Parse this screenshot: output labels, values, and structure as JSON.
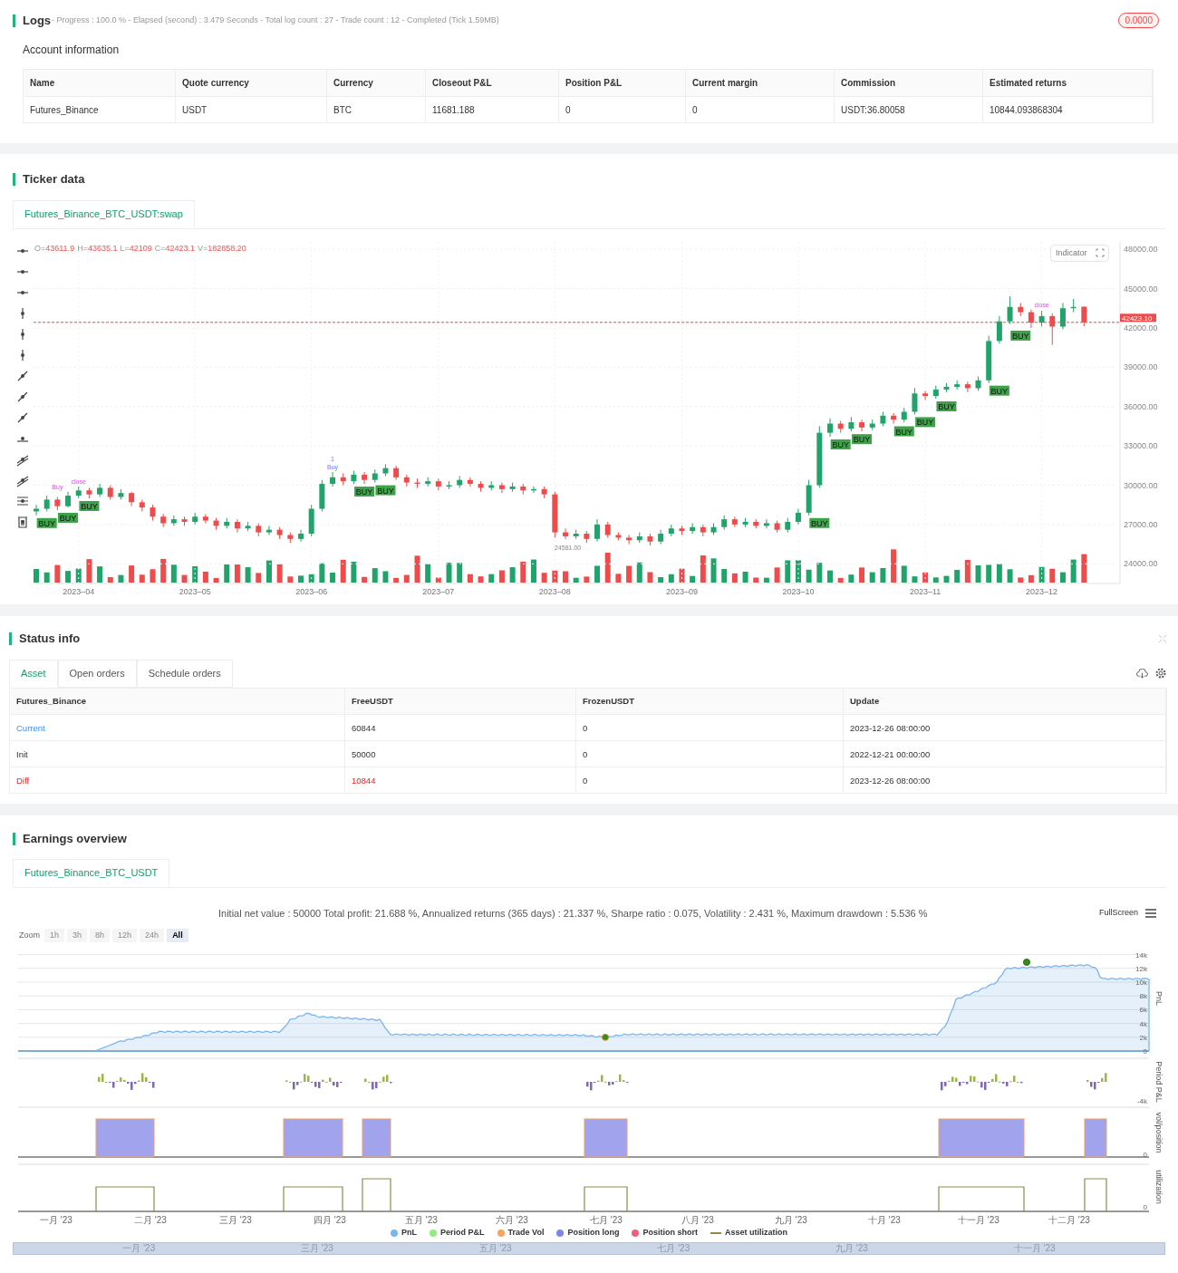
{
  "logs": {
    "title": "Logs",
    "progress": "- Progress : 100.0 % - Elapsed (second) : 3.479  Seconds - Total log count : 27 - Trade count : 12 - Completed (Tick 1.59MB)",
    "badge": "0.0000"
  },
  "account": {
    "title": "Account information",
    "columns": [
      "Name",
      "Quote currency",
      "Currency",
      "Closeout P&L",
      "Position P&L",
      "Current margin",
      "Commission",
      "Estimated returns"
    ],
    "rows": [
      [
        "Futures_Binance",
        "USDT",
        "BTC",
        "11681.188",
        "0",
        "0",
        "USDT:36.80058",
        "10844.093868304"
      ]
    ]
  },
  "ticker": {
    "title": "Ticker data",
    "tabs": [
      {
        "label": "Futures_Binance_BTC_USDT:swap",
        "selected": true
      }
    ],
    "ohlc": [
      {
        "label": "O=",
        "value": "43611.9"
      },
      {
        "label": "H=",
        "value": "43635.1"
      },
      {
        "label": "L=",
        "value": "42109"
      },
      {
        "label": "C=",
        "value": "42423.1"
      },
      {
        "label": "V=",
        "value": "182858.20"
      }
    ],
    "indicator_button": "Indicator",
    "low_label": "24581.00",
    "chart_data": {
      "type": "candlestick",
      "ylim": [
        22500,
        48560
      ],
      "grid": true,
      "ref_lines": [
        {
          "axis": "y",
          "value": 42423.1,
          "label": "42423.10"
        }
      ],
      "yticks": [
        {
          "value": 48000,
          "label": "48000.00"
        },
        {
          "value": 45000,
          "label": "45000.00"
        },
        {
          "value": 42000,
          "label": "42000.00"
        },
        {
          "value": 39000,
          "label": "39000.00"
        },
        {
          "value": 36000,
          "label": "36000.00"
        },
        {
          "value": 33000,
          "label": "33000.00"
        },
        {
          "value": 30000,
          "label": "30000.00"
        },
        {
          "value": 27000,
          "label": "27000.00"
        },
        {
          "value": 24000,
          "label": "24000.00"
        }
      ],
      "categories": [
        null,
        null,
        null,
        null,
        "2023–04",
        null,
        null,
        null,
        null,
        null,
        null,
        null,
        null,
        null,
        null,
        "2023–05",
        null,
        null,
        null,
        null,
        null,
        null,
        null,
        null,
        null,
        null,
        "2023–06",
        null,
        null,
        null,
        null,
        null,
        null,
        null,
        null,
        null,
        null,
        null,
        "2023–07",
        null,
        null,
        null,
        null,
        null,
        null,
        null,
        null,
        null,
        null,
        "2023–08",
        null,
        null,
        null,
        null,
        null,
        null,
        null,
        null,
        null,
        null,
        null,
        "2023–09",
        null,
        null,
        null,
        null,
        null,
        null,
        null,
        null,
        null,
        null,
        "2023–10",
        null,
        null,
        null,
        null,
        null,
        null,
        null,
        null,
        null,
        null,
        null,
        "2023–11",
        null,
        null,
        null,
        null,
        null,
        null,
        null,
        null,
        null,
        null,
        "2023–12",
        null,
        null,
        null,
        null
      ],
      "ohlc": [
        [
          28000,
          28500,
          27700,
          28200
        ],
        [
          28200,
          29200,
          28000,
          28900
        ],
        [
          28900,
          29100,
          28100,
          28400
        ],
        [
          28400,
          29500,
          28300,
          29200
        ],
        [
          29200,
          29900,
          29000,
          29600
        ],
        [
          29600,
          29800,
          29000,
          29300
        ],
        [
          29300,
          30100,
          29100,
          29800
        ],
        [
          29800,
          30000,
          28900,
          29100
        ],
        [
          29100,
          29700,
          28900,
          29400
        ],
        [
          29400,
          29500,
          28400,
          28700
        ],
        [
          28700,
          28900,
          28000,
          28300
        ],
        [
          28300,
          28500,
          27300,
          27600
        ],
        [
          27600,
          27800,
          26800,
          27100
        ],
        [
          27100,
          27700,
          26900,
          27400
        ],
        [
          27400,
          27600,
          26900,
          27200
        ],
        [
          27200,
          27900,
          27000,
          27600
        ],
        [
          27600,
          27800,
          27100,
          27300
        ],
        [
          27300,
          27500,
          26600,
          26900
        ],
        [
          26900,
          27500,
          26700,
          27200
        ],
        [
          27200,
          27400,
          26400,
          26700
        ],
        [
          26700,
          27200,
          26500,
          26900
        ],
        [
          26900,
          27100,
          26100,
          26400
        ],
        [
          26400,
          26900,
          26200,
          26600
        ],
        [
          26600,
          26800,
          25900,
          26200
        ],
        [
          26200,
          26400,
          25600,
          25900
        ],
        [
          25900,
          26600,
          25700,
          26300
        ],
        [
          26300,
          28500,
          26100,
          28200
        ],
        [
          28200,
          30400,
          28000,
          30100
        ],
        [
          30100,
          31000,
          29900,
          30600
        ],
        [
          30600,
          30900,
          30000,
          30300
        ],
        [
          30300,
          31100,
          30100,
          30800
        ],
        [
          30800,
          31000,
          30100,
          30400
        ],
        [
          30400,
          31200,
          30200,
          30900
        ],
        [
          30900,
          31600,
          30700,
          31300
        ],
        [
          31300,
          31500,
          30400,
          30600
        ],
        [
          30600,
          30800,
          29900,
          30200
        ],
        [
          30200,
          30500,
          29800,
          30100
        ],
        [
          30100,
          30600,
          29900,
          30300
        ],
        [
          30300,
          30500,
          29600,
          29900
        ],
        [
          29900,
          30300,
          29700,
          30000
        ],
        [
          30000,
          30700,
          29800,
          30400
        ],
        [
          30400,
          30600,
          29900,
          30100
        ],
        [
          30100,
          30300,
          29500,
          29800
        ],
        [
          29800,
          30300,
          29600,
          30000
        ],
        [
          30000,
          30200,
          29400,
          29700
        ],
        [
          29700,
          30200,
          29500,
          29900
        ],
        [
          29900,
          30100,
          29300,
          29600
        ],
        [
          29600,
          29900,
          29400,
          29700
        ],
        [
          29700,
          29900,
          29000,
          29300
        ],
        [
          29300,
          29500,
          26000,
          26400
        ],
        [
          26400,
          26700,
          25900,
          26100
        ],
        [
          26100,
          26600,
          25900,
          26300
        ],
        [
          26300,
          26500,
          25600,
          25900
        ],
        [
          25900,
          27400,
          25700,
          27000
        ],
        [
          27000,
          27200,
          26000,
          26200
        ],
        [
          26200,
          26400,
          25800,
          26000
        ],
        [
          26000,
          26200,
          25500,
          25800
        ],
        [
          25800,
          26400,
          25600,
          26100
        ],
        [
          26100,
          26300,
          25400,
          25700
        ],
        [
          25700,
          26600,
          25500,
          26300
        ],
        [
          26300,
          27000,
          26100,
          26700
        ],
        [
          26700,
          26900,
          26200,
          26500
        ],
        [
          26500,
          27100,
          26300,
          26800
        ],
        [
          26800,
          27000,
          26100,
          26400
        ],
        [
          26400,
          27100,
          26200,
          26800
        ],
        [
          26800,
          27700,
          26600,
          27400
        ],
        [
          27400,
          27600,
          26800,
          27000
        ],
        [
          27000,
          27500,
          26800,
          27200
        ],
        [
          27200,
          27400,
          26700,
          26900
        ],
        [
          26900,
          27400,
          26700,
          27100
        ],
        [
          27100,
          27300,
          26400,
          26600
        ],
        [
          26600,
          27500,
          26400,
          27200
        ],
        [
          27200,
          28200,
          27000,
          27900
        ],
        [
          27900,
          30400,
          27700,
          30000
        ],
        [
          30000,
          34500,
          29800,
          34000
        ],
        [
          34000,
          35100,
          33700,
          34700
        ],
        [
          34700,
          34900,
          34000,
          34300
        ],
        [
          34300,
          35200,
          34100,
          34800
        ],
        [
          34800,
          35000,
          34100,
          34400
        ],
        [
          34400,
          35000,
          34200,
          34700
        ],
        [
          34700,
          35600,
          34500,
          35300
        ],
        [
          35300,
          35500,
          34700,
          35000
        ],
        [
          35000,
          35900,
          34800,
          35600
        ],
        [
          35600,
          37400,
          35400,
          37000
        ],
        [
          37000,
          37200,
          36500,
          36800
        ],
        [
          36800,
          37600,
          36600,
          37300
        ],
        [
          37300,
          37800,
          37100,
          37500
        ],
        [
          37500,
          38000,
          37300,
          37700
        ],
        [
          37700,
          37900,
          37100,
          37400
        ],
        [
          37400,
          38300,
          37200,
          38000
        ],
        [
          38000,
          41400,
          37800,
          41000
        ],
        [
          41000,
          42900,
          40800,
          42500
        ],
        [
          42500,
          44400,
          42300,
          43600
        ],
        [
          43600,
          43900,
          42900,
          43200
        ],
        [
          43200,
          43400,
          42000,
          42400
        ],
        [
          42400,
          43300,
          42100,
          42900
        ],
        [
          42900,
          43100,
          40700,
          42100
        ],
        [
          42100,
          43900,
          41900,
          43500
        ],
        [
          43500,
          44200,
          43200,
          43600
        ],
        [
          43611.9,
          43635.1,
          42109,
          42423.1
        ]
      ]
    },
    "markers": [
      {
        "kind": "buy",
        "label": "BUY"
      },
      {
        "kind": "buy",
        "label": "BUY"
      },
      {
        "kind": "buy",
        "label": "BUY"
      },
      {
        "kind": "buy",
        "label": "BUY"
      },
      {
        "kind": "buy",
        "label": "BUY"
      },
      {
        "kind": "buy",
        "label": "BUY"
      },
      {
        "kind": "buy",
        "label": "BUY"
      },
      {
        "kind": "buy",
        "label": "BUY"
      },
      {
        "kind": "buy",
        "label": "BUY"
      },
      {
        "kind": "buy",
        "label": "BUY"
      },
      {
        "kind": "buy",
        "label": "BUY"
      },
      {
        "kind": "buy",
        "label": "BUY"
      },
      {
        "kind": "buy",
        "label": "BUY"
      },
      {
        "kind": "signal",
        "label": "Buy"
      },
      {
        "kind": "signal",
        "label": "close"
      },
      {
        "kind": "order",
        "label": "Buy"
      },
      {
        "kind": "order",
        "label": "1"
      },
      {
        "kind": "signal",
        "label": "close"
      }
    ]
  },
  "status": {
    "title": "Status info",
    "tabs": [
      {
        "label": "Asset",
        "selected": true
      },
      {
        "label": "Open orders",
        "selected": false
      },
      {
        "label": "Schedule orders",
        "selected": false
      }
    ],
    "columns": [
      "Futures_Binance",
      "FreeUSDT",
      "FrozenUSDT",
      "Update"
    ],
    "rows": [
      {
        "kind": "current",
        "cells": [
          "Current",
          "60844",
          "0",
          "2023-12-26 08:00:00"
        ]
      },
      {
        "kind": "plain",
        "cells": [
          "Init",
          "50000",
          "0",
          "2022-12-21 00:00:00"
        ]
      },
      {
        "kind": "diff",
        "cells": [
          "Diff",
          "10844",
          "0",
          "2023-12-26 08:00:00"
        ]
      }
    ]
  },
  "earnings": {
    "title": "Earnings overview",
    "tabs": [
      {
        "label": "Futures_Binance_BTC_USDT",
        "selected": true
      }
    ],
    "summary": "Initial net value : 50000 Total profit: 21.688 %, Annualized returns (365 days) : 21.337 %, Sharpe ratio : 0.075, Volatility : 2.431 %, Maximum drawdown : 5.536 %",
    "fullscreen": "FullScreen",
    "zoom_label": "Zoom",
    "zoom_buttons": [
      {
        "label": "1h",
        "selected": false
      },
      {
        "label": "3h",
        "selected": false
      },
      {
        "label": "8h",
        "selected": false
      },
      {
        "label": "12h",
        "selected": false
      },
      {
        "label": "24h",
        "selected": false
      },
      {
        "label": "All",
        "selected": true
      }
    ],
    "axis_titles": [
      "PnL",
      "Period P&L",
      "vol/position",
      "utilization"
    ],
    "pnl_ticks": [
      "14k",
      "12k",
      "10k",
      "8k",
      "6k",
      "4k",
      "2k",
      "0"
    ],
    "period_ticks": [
      "-4k"
    ],
    "position_ticks": [
      "0"
    ],
    "util_ticks": [
      "0"
    ],
    "xlabels": [
      "一月 '23",
      "二月 '23",
      "三月 '23",
      "四月 '23",
      "五月 '23",
      "六月 '23",
      "七月 '23",
      "八月 '23",
      "九月 '23",
      "十月 '23",
      "十一月 '23",
      "十二月 '23"
    ],
    "legend": [
      {
        "kind": "dot",
        "label": "PnL",
        "color": "#7cb5ec"
      },
      {
        "kind": "dot",
        "label": "Period P&L",
        "color": "#90ed7d"
      },
      {
        "kind": "dot",
        "label": "Trade Vol",
        "color": "#f7a35c"
      },
      {
        "kind": "dot",
        "label": "Position long",
        "color": "#8085e9"
      },
      {
        "kind": "dot",
        "label": "Position short",
        "color": "#f15c80"
      },
      {
        "kind": "line",
        "label": "Asset utilization",
        "color": "#8d8d4a"
      }
    ],
    "navigator_labels": [
      "一月 '23",
      "三月 '23",
      "五月 '23",
      "七月 '23",
      "九月 '23",
      "十一月 '23"
    ]
  }
}
